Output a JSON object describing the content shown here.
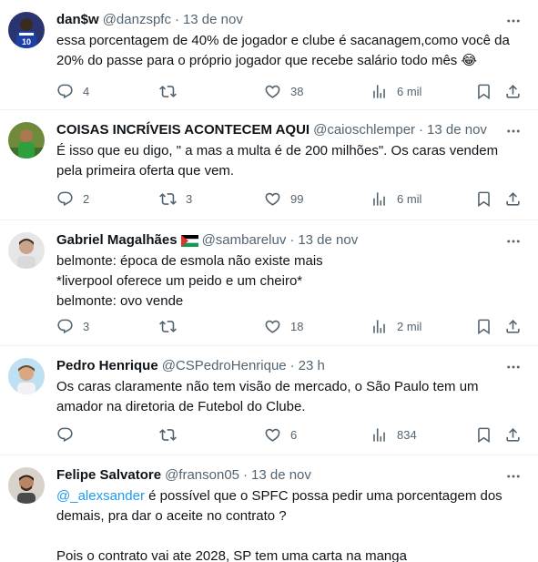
{
  "tweets": [
    {
      "name": "dan$w",
      "handle": "@danzspfc",
      "time": "13 de nov",
      "lines": [
        "essa porcentagem de 40% de jogador e clube é sacanagem,como você da",
        "20% do passe para o próprio jogador que recebe salário todo mês 😂"
      ],
      "replies": "4",
      "retweets": "",
      "likes": "38",
      "views": "6 mil"
    },
    {
      "name": "COISAS INCRÍVEIS ACONTECEM AQUI",
      "handle": "@caioschlemper",
      "time": "13 de nov",
      "lines": [
        "É isso que eu digo, \" a mas a multa é de 200 milhões\". Os caras vendem",
        "pela primeira oferta que vem."
      ],
      "replies": "2",
      "retweets": "3",
      "likes": "99",
      "views": "6 mil"
    },
    {
      "name": "Gabriel Magalhães",
      "handle": "@sambareluv",
      "time": "13 de nov",
      "lines": [
        "belmonte: época de esmola não existe mais",
        "*liverpool oferece um peido e um cheiro*",
        "belmonte: ovo vende"
      ],
      "replies": "3",
      "retweets": "",
      "likes": "18",
      "views": "2 mil"
    },
    {
      "name": "Pedro Henrique",
      "handle": "@CSPedroHenrique",
      "time": "23 h",
      "lines": [
        "Os caras claramente não tem visão de mercado, o São Paulo tem um",
        "amador na diretoria de Futebol do Clube."
      ],
      "replies": "",
      "retweets": "",
      "likes": "6",
      "views": "834"
    },
    {
      "name": "Felipe Salvatore",
      "handle": "@franson05",
      "time": "13 de nov",
      "mention": "@_alexsander",
      "lines": [
        " é possível que o SPFC possa pedir uma porcentagem dos",
        "demais, pra dar o aceite no contrato ?",
        "",
        "Pois o contrato vai ate 2028, SP tem uma carta na manga"
      ]
    }
  ],
  "icons": {
    "reply": "reply-icon",
    "retweet": "retweet-icon",
    "like": "heart-icon",
    "views": "views-chart-icon",
    "bookmark": "bookmark-icon",
    "share": "share-icon",
    "more": "more-dots-icon",
    "flag": "palestine-flag-icon"
  },
  "colors": {
    "text": "#0f1419",
    "muted": "#536471",
    "link": "#1d9bf0",
    "divider": "#eff3f4"
  }
}
